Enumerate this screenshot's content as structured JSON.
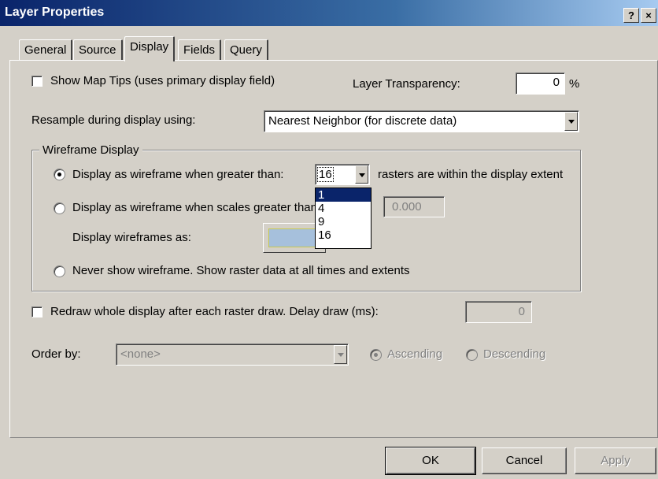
{
  "window": {
    "title": "Layer Properties",
    "help_label": "?",
    "close_label": "×"
  },
  "tabs": [
    {
      "label": "General"
    },
    {
      "label": "Source"
    },
    {
      "label": "Display",
      "active": true
    },
    {
      "label": "Fields"
    },
    {
      "label": "Query"
    }
  ],
  "display": {
    "show_map_tips": {
      "label": "Show Map Tips (uses primary display field)",
      "checked": false
    },
    "transparency": {
      "label": "Layer Transparency:",
      "value": "0",
      "unit": "%"
    },
    "resample": {
      "label": "Resample during display using:",
      "value": "Nearest Neighbor (for discrete data)"
    },
    "wireframe": {
      "legend": "Wireframe Display",
      "option_greater": {
        "label": "Display as wireframe when greater than:",
        "checked": true
      },
      "count_value": "16",
      "count_suffix": "rasters are within the display extent",
      "count_options": [
        "1",
        "4",
        "9",
        "16"
      ],
      "count_highlighted": "1",
      "option_scale": {
        "label": "Display as wireframe when scales greater than",
        "checked": false
      },
      "scale_value": "0.000",
      "wireframe_as_label": "Display wireframes as:",
      "wireframe_color": "#a6c0dc",
      "option_never": {
        "label": "Never show wireframe. Show raster data at all times and extents",
        "checked": false
      }
    },
    "redraw": {
      "label": "Redraw whole display after each raster draw. Delay draw (ms):",
      "checked": false,
      "value": "0"
    },
    "order_by": {
      "label": "Order by:",
      "value": "<none>",
      "ascending_label": "Ascending",
      "descending_label": "Descending"
    }
  },
  "buttons": {
    "ok": "OK",
    "cancel": "Cancel",
    "apply": "Apply"
  }
}
